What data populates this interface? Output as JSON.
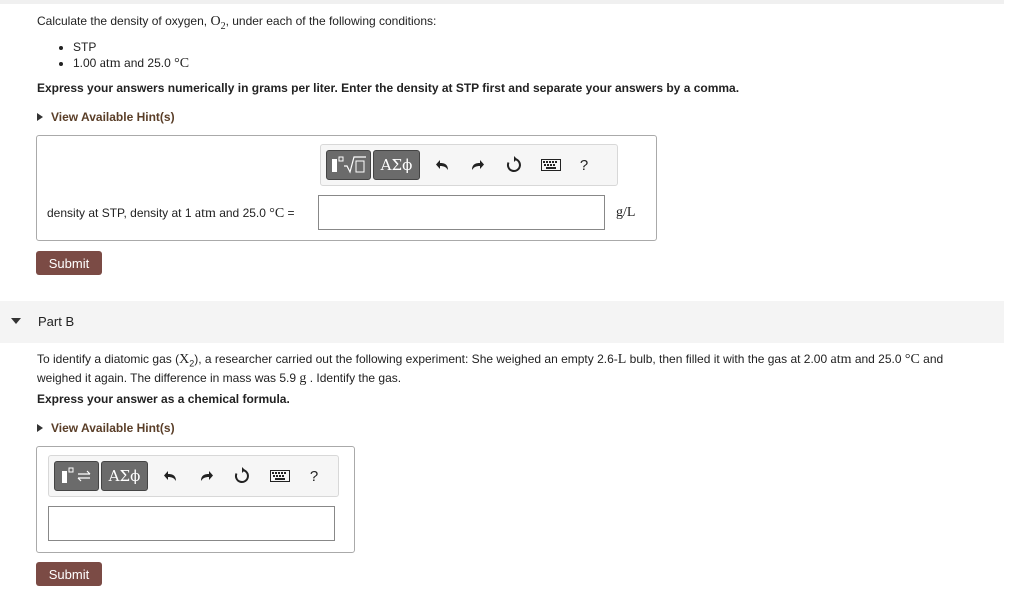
{
  "parta": {
    "prompt_pre": "Calculate the density of oxygen, ",
    "prompt_formula": "O",
    "prompt_sub": "2",
    "prompt_post": ", under each of the following conditions:",
    "cond1": "STP",
    "cond2_pre": "1.00 ",
    "cond2_unit": "atm",
    "cond2_mid": " and 25.0 ",
    "cond2_unit2": "°C",
    "express": "Express your answers numerically in grams per liter. Enter the density at STP first and separate your answers by a comma.",
    "hint": "View Available Hint(s)",
    "label_pre": "density at STP, density at 1 ",
    "label_unit": "atm",
    "label_mid": " and 25.0 ",
    "label_unit2": "°C",
    "label_eq": " =",
    "units": "g/L",
    "toolbar_greek": "ΑΣϕ",
    "help": "?",
    "submit": "Submit"
  },
  "partb": {
    "title": "Part B",
    "text_a": "To identify a diatomic gas (",
    "text_X": "X",
    "text_sub": "2",
    "text_b": "), a researcher carried out the following experiment: She weighed an empty 2.6-",
    "text_L": "L",
    "text_c": " bulb, then filled it with the gas at 2.00 ",
    "text_atm": "atm",
    "text_d": " and 25.0 ",
    "text_C": "°C",
    "text_e": " and weighed it again. The difference in mass was 5.9 ",
    "text_g": "g",
    "text_f": " . Identify the gas.",
    "express": "Express your answer as a chemical formula.",
    "hint": "View Available Hint(s)",
    "toolbar_greek": "ΑΣϕ",
    "help": "?",
    "submit": "Submit"
  }
}
